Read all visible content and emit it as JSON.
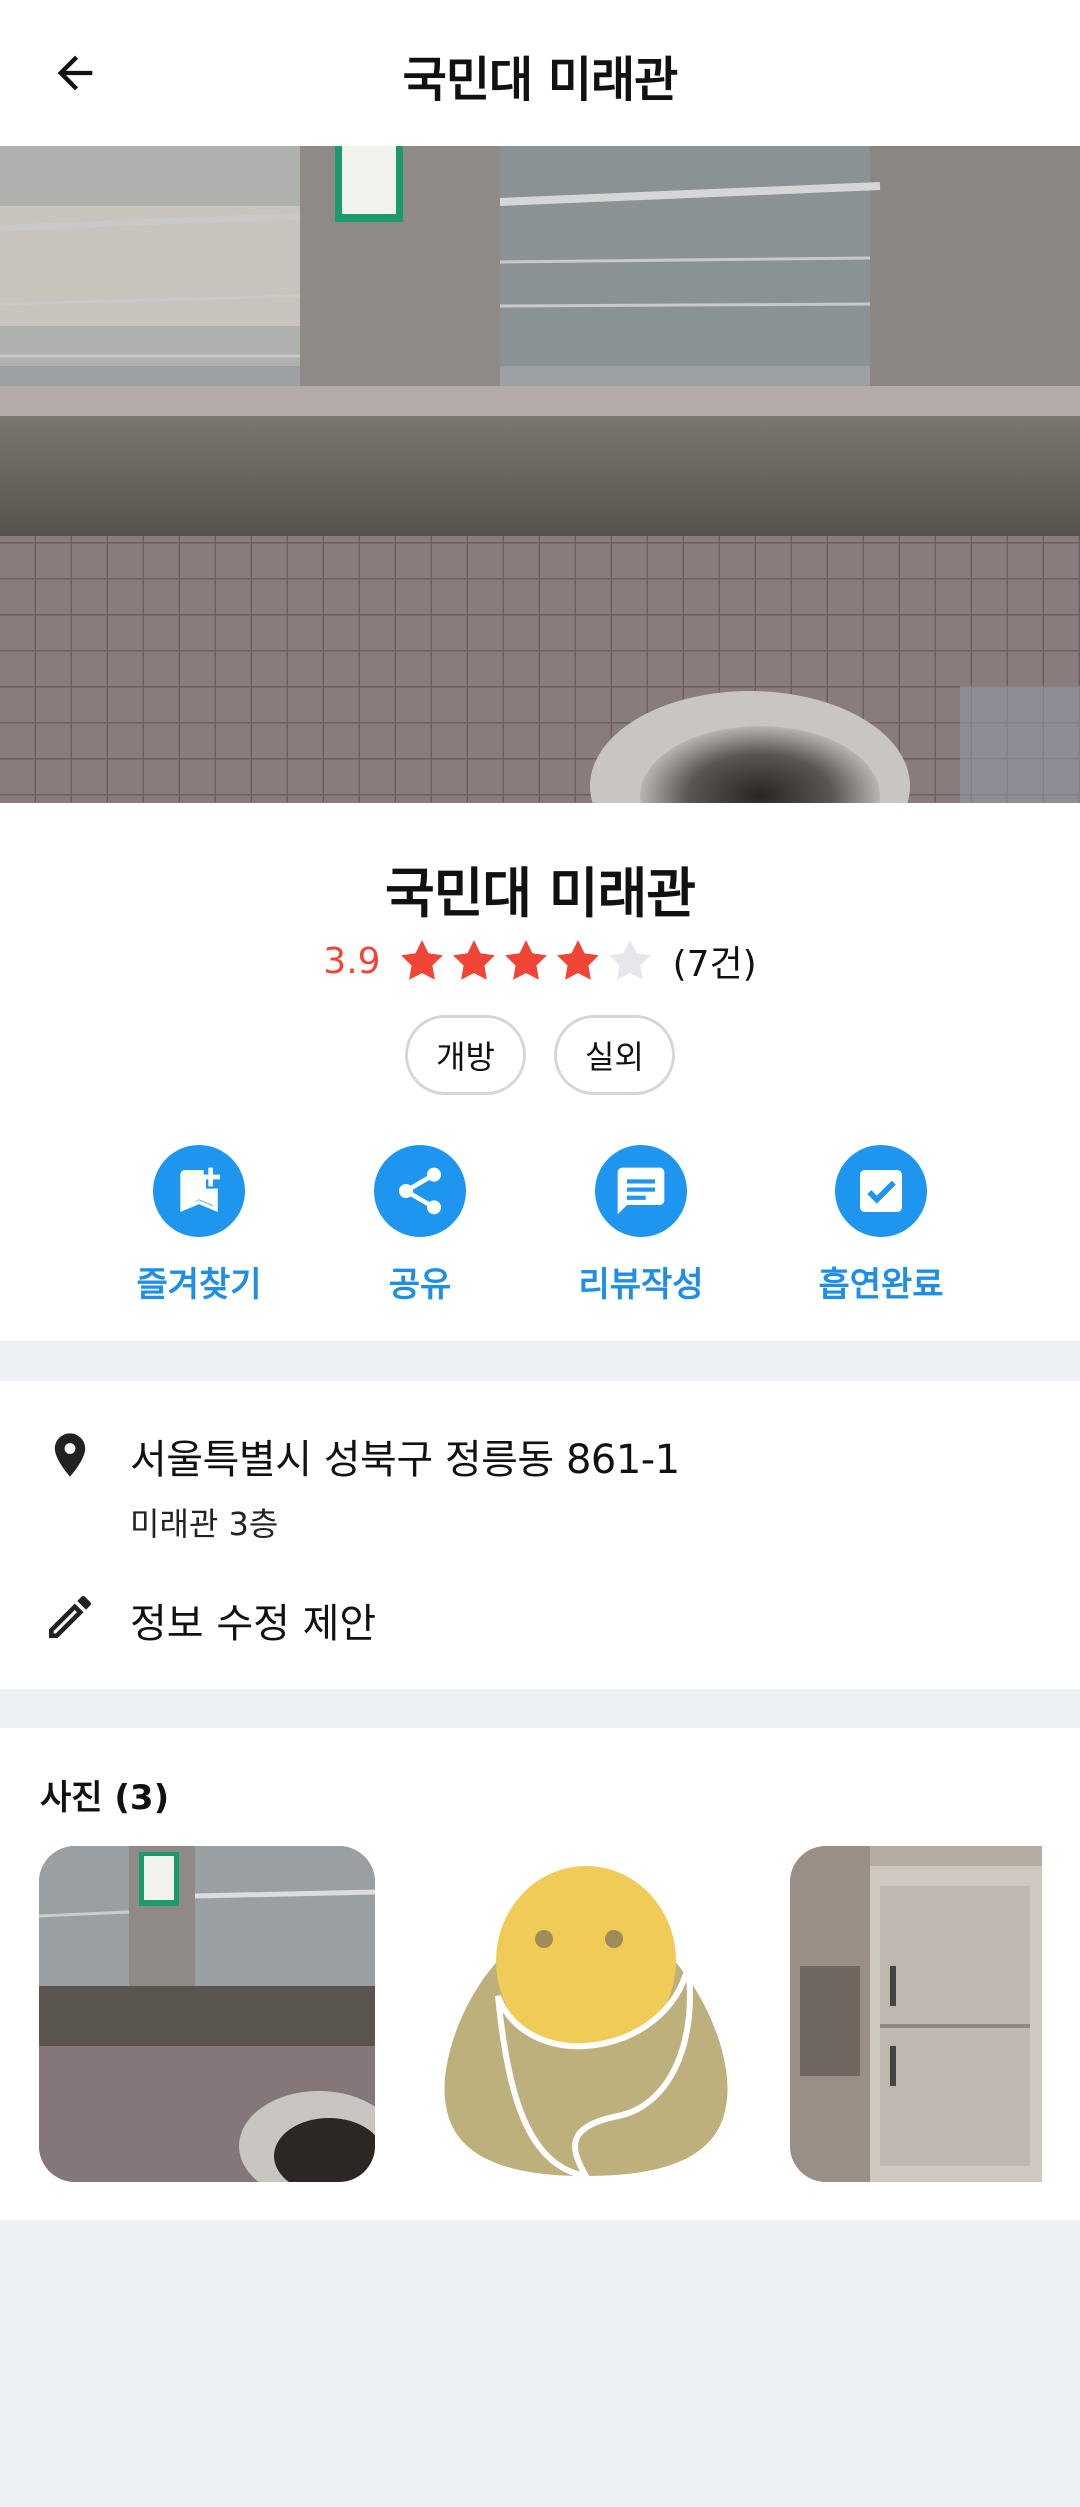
{
  "header": {
    "title": "국민대 미래관"
  },
  "place": {
    "name": "국민대 미래관",
    "rating": 3.9,
    "rating_text": "3.9",
    "review_count_text": "(7건)",
    "tags": [
      "개방",
      "실외"
    ]
  },
  "actions": [
    {
      "label": "즐겨찾기",
      "icon": "bookmark-add-icon"
    },
    {
      "label": "공유",
      "icon": "share-icon"
    },
    {
      "label": "리뷰작성",
      "icon": "chat-icon"
    },
    {
      "label": "흡연완료",
      "icon": "check-box-icon"
    }
  ],
  "address": {
    "main": "서울특별시 성북구 정릉동 861-1",
    "detail": "미래관 3층",
    "edit_label": "정보 수정 제안"
  },
  "photos": {
    "title": "사진 (3)",
    "count": 3
  },
  "colors": {
    "accent": "#1e96f0",
    "rating": "#f04437",
    "background": "#edf0f5"
  }
}
